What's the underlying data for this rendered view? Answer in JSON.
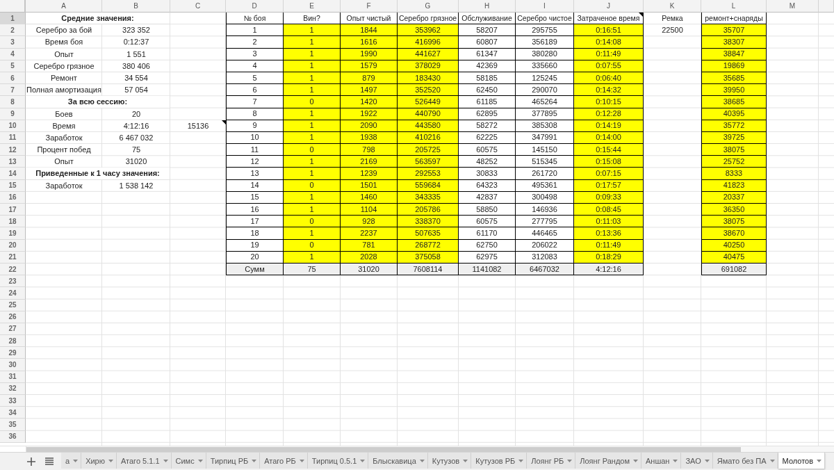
{
  "column_headers": [
    "A",
    "B",
    "C",
    "D",
    "E",
    "F",
    "G",
    "H",
    "I",
    "J",
    "K",
    "L",
    "M"
  ],
  "row_headers": [
    {
      "label": "1",
      "selected": true
    },
    {
      "label": "2",
      "selected": false
    },
    {
      "label": "3",
      "selected": false
    },
    {
      "label": "4",
      "selected": false
    },
    {
      "label": "5",
      "selected": false
    },
    {
      "label": "6",
      "selected": false
    },
    {
      "label": "7",
      "selected": false
    },
    {
      "label": "8",
      "selected": false
    },
    {
      "label": "9",
      "selected": false
    },
    {
      "label": "10",
      "selected": false
    },
    {
      "label": "11",
      "selected": false
    },
    {
      "label": "12",
      "selected": false
    },
    {
      "label": "13",
      "selected": false
    },
    {
      "label": "14",
      "selected": false
    },
    {
      "label": "15",
      "selected": false
    },
    {
      "label": "16",
      "selected": false
    },
    {
      "label": "17",
      "selected": false
    },
    {
      "label": "18",
      "selected": false
    },
    {
      "label": "19",
      "selected": false
    },
    {
      "label": "20",
      "selected": false
    },
    {
      "label": "21",
      "selected": false
    },
    {
      "label": "22",
      "selected": false
    },
    {
      "label": "23",
      "selected": false
    },
    {
      "label": "24",
      "selected": false
    },
    {
      "label": "25",
      "selected": false
    },
    {
      "label": "26",
      "selected": false
    },
    {
      "label": "27",
      "selected": false
    },
    {
      "label": "28",
      "selected": false
    },
    {
      "label": "29",
      "selected": false
    },
    {
      "label": "30",
      "selected": false
    },
    {
      "label": "31",
      "selected": false
    },
    {
      "label": "32",
      "selected": false
    },
    {
      "label": "33",
      "selected": false
    },
    {
      "label": "34",
      "selected": false
    },
    {
      "label": "35",
      "selected": false
    },
    {
      "label": "36",
      "selected": false
    }
  ],
  "summary": {
    "sections": [
      {
        "title": "Средние значения:",
        "items": [
          {
            "label": "Серебро за бой",
            "value": "323 352"
          },
          {
            "label": "Время боя",
            "value": "0:12:37"
          },
          {
            "label": "Опыт",
            "value": "1 551"
          },
          {
            "label": "Серебро грязное",
            "value": "380 406"
          },
          {
            "label": "Ремонт",
            "value": "34 554"
          },
          {
            "label": "Полная амортизация",
            "value": "57 054"
          }
        ]
      },
      {
        "title": "За всю сессию:",
        "items": [
          {
            "label": "Боев",
            "value": "20"
          },
          {
            "label": "Время",
            "value": "4:12:16",
            "extra": {
              "value": "15136",
              "has_note": true
            }
          },
          {
            "label": "Заработок",
            "value": "6 467 032"
          },
          {
            "label": "Процент побед",
            "value": "75"
          },
          {
            "label": "Опыт",
            "value": "31020"
          }
        ]
      },
      {
        "title": "Приведенные к 1 часу значения:",
        "items": [
          {
            "label": "Заработок",
            "value": "1 538 142"
          }
        ]
      }
    ]
  },
  "battle_table": {
    "columns": [
      {
        "title": "№ боя",
        "highlighted": false,
        "has_note": false
      },
      {
        "title": "Вин?",
        "highlighted": true,
        "has_note": false
      },
      {
        "title": "Опыт чистый",
        "highlighted": true,
        "has_note": false
      },
      {
        "title": "Серебро грязное",
        "highlighted": true,
        "has_note": false
      },
      {
        "title": "Обслуживание",
        "highlighted": false,
        "has_note": false
      },
      {
        "title": "Серебро чистое",
        "highlighted": false,
        "has_note": false
      },
      {
        "title": "Затраченое время",
        "highlighted": true,
        "has_note": true
      }
    ],
    "rows": [
      [
        "1",
        "1",
        "1844",
        "353962",
        "58207",
        "295755",
        "0:16:51"
      ],
      [
        "2",
        "1",
        "1616",
        "416996",
        "60807",
        "356189",
        "0:14:08"
      ],
      [
        "3",
        "1",
        "1990",
        "441627",
        "61347",
        "380280",
        "0:11:49"
      ],
      [
        "4",
        "1",
        "1579",
        "378029",
        "42369",
        "335660",
        "0:07:55"
      ],
      [
        "5",
        "1",
        "879",
        "183430",
        "58185",
        "125245",
        "0:06:40"
      ],
      [
        "6",
        "1",
        "1497",
        "352520",
        "62450",
        "290070",
        "0:14:32"
      ],
      [
        "7",
        "0",
        "1420",
        "526449",
        "61185",
        "465264",
        "0:10:15"
      ],
      [
        "8",
        "1",
        "1922",
        "440790",
        "62895",
        "377895",
        "0:12:28"
      ],
      [
        "9",
        "1",
        "2090",
        "443580",
        "58272",
        "385308",
        "0:14:19"
      ],
      [
        "10",
        "1",
        "1938",
        "410216",
        "62225",
        "347991",
        "0:14:00"
      ],
      [
        "11",
        "0",
        "798",
        "205725",
        "60575",
        "145150",
        "0:15:44"
      ],
      [
        "12",
        "1",
        "2169",
        "563597",
        "48252",
        "515345",
        "0:15:08"
      ],
      [
        "13",
        "1",
        "1239",
        "292553",
        "30833",
        "261720",
        "0:07:15"
      ],
      [
        "14",
        "0",
        "1501",
        "559684",
        "64323",
        "495361",
        "0:17:57"
      ],
      [
        "15",
        "1",
        "1460",
        "343335",
        "42837",
        "300498",
        "0:09:33"
      ],
      [
        "16",
        "1",
        "1104",
        "205786",
        "58850",
        "146936",
        "0:08:45"
      ],
      [
        "17",
        "0",
        "928",
        "338370",
        "60575",
        "277795",
        "0:11:03"
      ],
      [
        "18",
        "1",
        "2237",
        "507635",
        "61170",
        "446465",
        "0:13:36"
      ],
      [
        "19",
        "0",
        "781",
        "268772",
        "62750",
        "206022",
        "0:11:49"
      ],
      [
        "20",
        "1",
        "2028",
        "375058",
        "62975",
        "312083",
        "0:18:29"
      ]
    ],
    "totals": [
      "Сумм",
      "75",
      "31020",
      "7608114",
      "1141082",
      "6467032",
      "4:12:16"
    ]
  },
  "repair": {
    "title": "Ремка",
    "value": "22500"
  },
  "repair_ammo": {
    "title": "ремонт+снаряды",
    "highlighted": true,
    "values": [
      "35707",
      "38307",
      "38847",
      "19869",
      "35685",
      "39950",
      "38685",
      "40395",
      "35772",
      "39725",
      "38075",
      "25752",
      "8333",
      "41823",
      "20337",
      "36350",
      "38075",
      "38670",
      "40250",
      "40475"
    ],
    "total": "691082"
  },
  "sheet_tabs": [
    {
      "label": "а",
      "selected": false
    },
    {
      "label": "Хирю",
      "selected": false
    },
    {
      "label": "Атаго 5.1.1",
      "selected": false
    },
    {
      "label": "Симс",
      "selected": false
    },
    {
      "label": "Тирпиц РБ",
      "selected": false
    },
    {
      "label": "Атаго РБ",
      "selected": false
    },
    {
      "label": "Тирпиц 0.5.1",
      "selected": false
    },
    {
      "label": "Блыскавица",
      "selected": false
    },
    {
      "label": "Кутузов",
      "selected": false
    },
    {
      "label": "Кутузов РБ",
      "selected": false
    },
    {
      "label": "Лоянг РБ",
      "selected": false
    },
    {
      "label": "Лоянг Рандом",
      "selected": false
    },
    {
      "label": "Аншан",
      "selected": false
    },
    {
      "label": "ЗАО",
      "selected": false
    },
    {
      "label": "Ямато без ПА",
      "selected": false
    },
    {
      "label": "Молотов",
      "selected": true
    }
  ]
}
